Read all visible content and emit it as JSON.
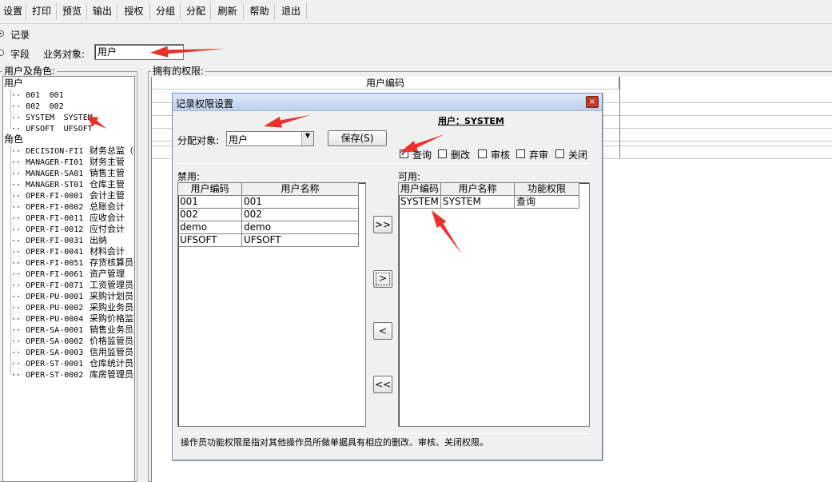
{
  "menu": [
    "设置",
    "打印",
    "预览",
    "输出",
    "授权",
    "分组",
    "分配",
    "刷新",
    "帮助",
    "退出"
  ],
  "mode": {
    "record_label": "记录",
    "field_label": "字段"
  },
  "business_object": {
    "label": "业务对象:",
    "value": "用户"
  },
  "tree": {
    "group_label": "用户及角色:",
    "root_users": "用户",
    "users": [
      {
        "code": "001",
        "name": "001"
      },
      {
        "code": "002",
        "name": "002"
      },
      {
        "code": "SYSTEM",
        "name": "SYSTEM"
      },
      {
        "code": "UFSOFT",
        "name": "UFSOFT"
      }
    ],
    "root_roles": "角色",
    "roles": [
      {
        "code": "DECISION-FI1",
        "name": "财务总监（C"
      },
      {
        "code": "MANAGER-FI01",
        "name": "财务主管"
      },
      {
        "code": "MANAGER-SA01",
        "name": "销售主管"
      },
      {
        "code": "MANAGER-ST01",
        "name": "仓库主管"
      },
      {
        "code": "OPER-FI-0001",
        "name": "会计主管"
      },
      {
        "code": "OPER-FI-0002",
        "name": "总账会计"
      },
      {
        "code": "OPER-FI-0011",
        "name": "应收会计"
      },
      {
        "code": "OPER-FI-0012",
        "name": "应付会计"
      },
      {
        "code": "OPER-FI-0031",
        "name": "出纳"
      },
      {
        "code": "OPER-FI-0041",
        "name": "材料会计"
      },
      {
        "code": "OPER-FI-0051",
        "name": "存货核算员"
      },
      {
        "code": "OPER-FI-0061",
        "name": "资产管理"
      },
      {
        "code": "OPER-FI-0071",
        "name": "工资管理员"
      },
      {
        "code": "OPER-PU-0001",
        "name": "采购计划员"
      },
      {
        "code": "OPER-PU-0002",
        "name": "采购业务员"
      },
      {
        "code": "OPER-PU-0004",
        "name": "采购价格监控"
      },
      {
        "code": "OPER-SA-0001",
        "name": "销售业务员"
      },
      {
        "code": "OPER-SA-0002",
        "name": "价格监管员"
      },
      {
        "code": "OPER-SA-0003",
        "name": "信用监管员"
      },
      {
        "code": "OPER-ST-0001",
        "name": "仓库统计员"
      },
      {
        "code": "OPER-ST-0002",
        "name": "库房管理员"
      }
    ]
  },
  "permissions": {
    "group_label": "拥有的权限:",
    "column_header": "用户编码"
  },
  "dialog": {
    "title": "记录权限设置",
    "close_glyph": "×",
    "assign_label": "分配对象:",
    "assign_value": "用户",
    "save_label": "保存(S)",
    "current_user": "用户：SYSTEM",
    "checks": [
      {
        "label": "查询",
        "checked": true
      },
      {
        "label": "删改",
        "checked": false
      },
      {
        "label": "审核",
        "checked": false
      },
      {
        "label": "弃审",
        "checked": false
      },
      {
        "label": "关闭",
        "checked": false
      }
    ],
    "forbidden_label": "禁用:",
    "forbidden_headers": [
      "用户编码",
      "用户名称"
    ],
    "forbidden_rows": [
      [
        "001",
        "001"
      ],
      [
        "002",
        "002"
      ],
      [
        "demo",
        "demo"
      ],
      [
        "UFSOFT",
        "UFSOFT"
      ]
    ],
    "available_label": "可用:",
    "available_headers": [
      "用户编码",
      "用户名称",
      "功能权限"
    ],
    "available_rows": [
      [
        "SYSTEM",
        "SYSTEM",
        "查询"
      ]
    ],
    "move_buttons": [
      ">>",
      ">",
      "<",
      "<<"
    ],
    "note": "操作员功能权限是指对其他操作员所做单据具有相应的删改、审核、关闭权限。"
  },
  "colors": {
    "annotation": "#e8322a",
    "title_bar": "#c9daf2"
  }
}
